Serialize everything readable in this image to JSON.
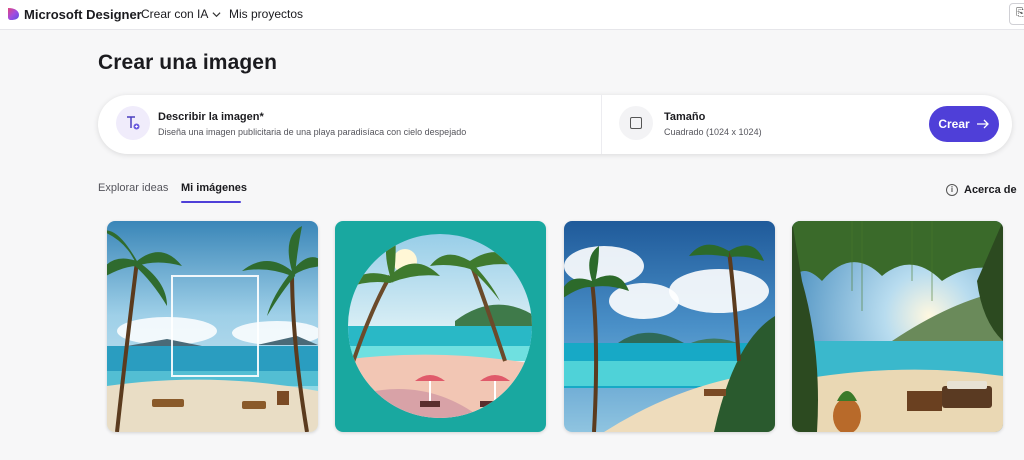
{
  "topbar": {
    "app_title": "Microsoft Designer",
    "nav_create": "Crear con IA",
    "nav_projects": "Mis proyectos",
    "logo_icon": "microsoft-designer-logo"
  },
  "page": {
    "title": "Crear una imagen"
  },
  "prompt": {
    "describe_label": "Describir la imagen*",
    "describe_value": "Diseña una imagen publicitaria de una playa paradisíaca con cielo despejado",
    "size_label": "Tamaño",
    "size_value": "Cuadrado (1024 x 1024)",
    "create_label": "Crear"
  },
  "tabs": {
    "explore": "Explorar ideas",
    "mine": "Mi imágenes",
    "active": "mine"
  },
  "about": {
    "label": "Acerca de"
  },
  "colors": {
    "accent": "#4f3fd8",
    "background": "#f7f7f8"
  },
  "images": [
    {
      "subject": "beach-with-neon-frame"
    },
    {
      "subject": "beach-in-circle-on-teal"
    },
    {
      "subject": "tropical-bay-with-palms"
    },
    {
      "subject": "jungle-beach-with-terrace"
    }
  ]
}
